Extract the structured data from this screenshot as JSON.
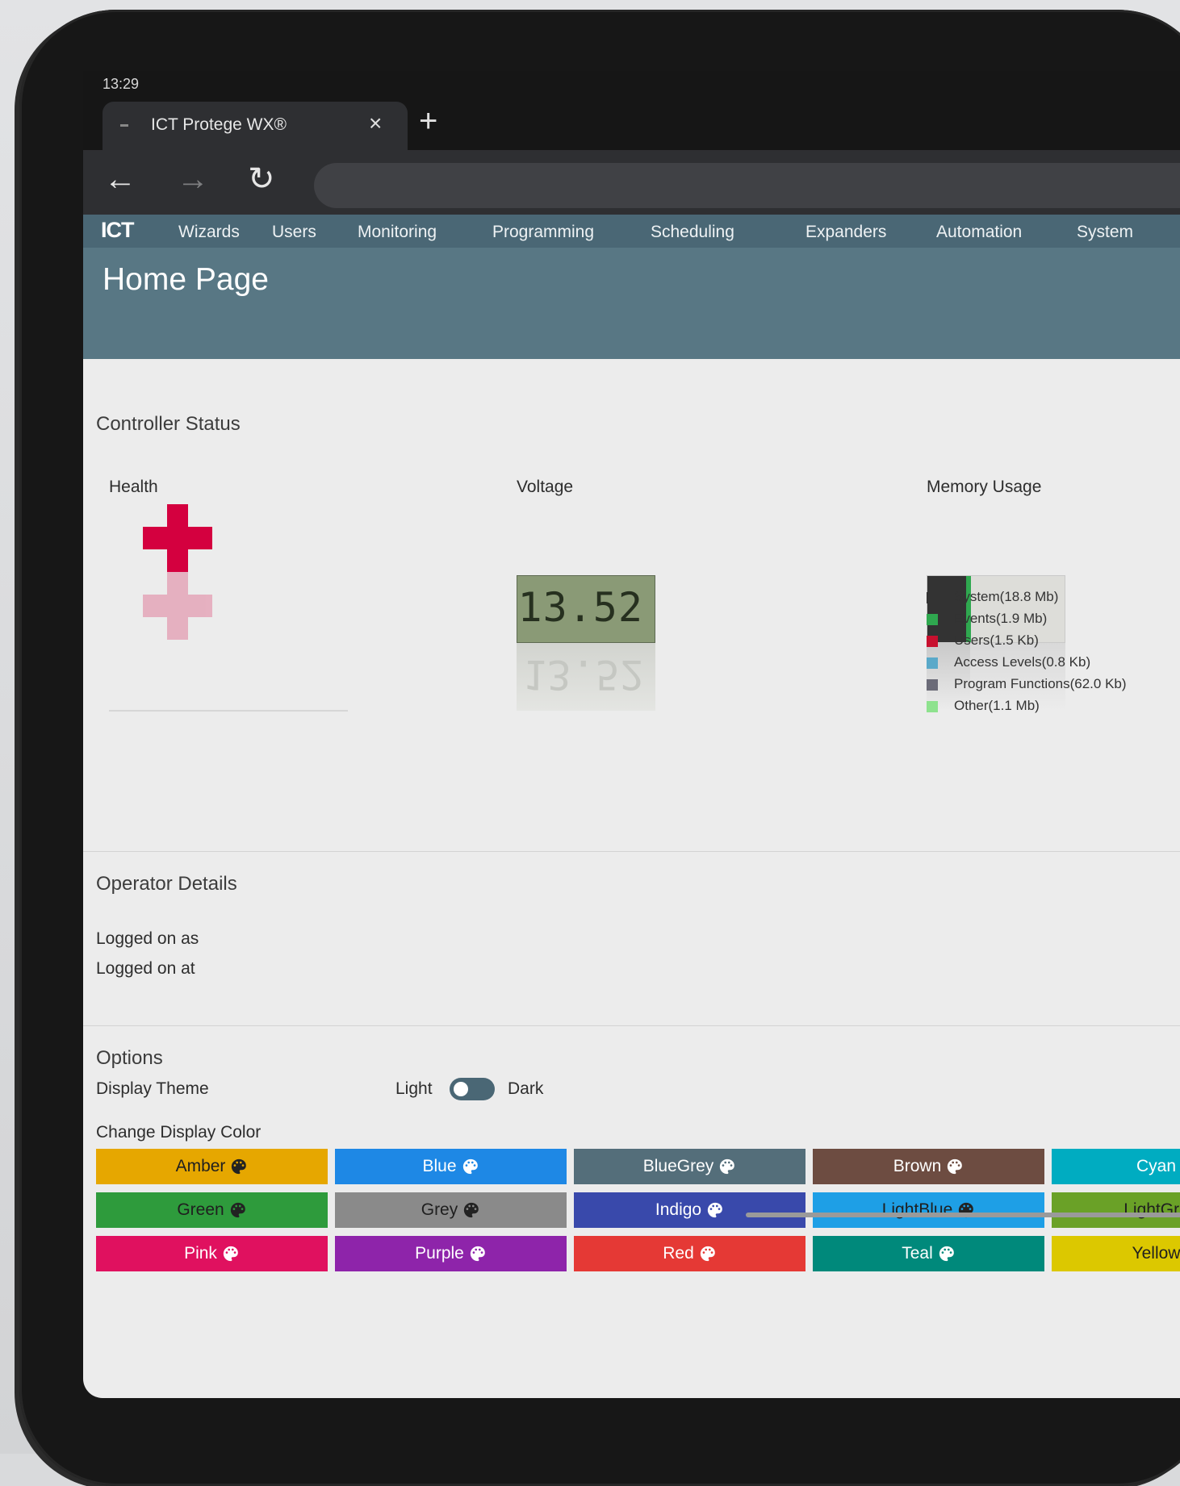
{
  "browser": {
    "clock": "13:29",
    "tab_title": "ICT Protege WX®",
    "tab_close": "×",
    "new_tab": "+",
    "back": "←",
    "forward": "→",
    "reload": "↻"
  },
  "nav": {
    "logo": "ICT",
    "items": [
      "Wizards",
      "Users",
      "Monitoring",
      "Programming",
      "Scheduling",
      "Expanders",
      "Automation",
      "System"
    ]
  },
  "page_title": "Home Page",
  "controller_status": {
    "title": "Controller Status",
    "health": {
      "label": "Health",
      "color": "#d4003f"
    },
    "voltage": {
      "label": "Voltage",
      "value": "13.52"
    },
    "memory": {
      "label": "Memory Usage",
      "legend": [
        {
          "label": "System(18.8 Mb)",
          "color": "#333333"
        },
        {
          "label": "Events(1.9 Mb)",
          "color": "#2fa84f"
        },
        {
          "label": "Users(1.5 Kb)",
          "color": "#c8102e"
        },
        {
          "label": "Access Levels(0.8 Kb)",
          "color": "#5aa9c9"
        },
        {
          "label": "Program Functions(62.0 Kb)",
          "color": "#6b6b78"
        },
        {
          "label": "Other(1.1 Mb)",
          "color": "#8ee28e"
        }
      ]
    }
  },
  "operator": {
    "title": "Operator Details",
    "logged_on_as": "Logged on as",
    "logged_on_at": "Logged on at"
  },
  "options": {
    "title": "Options",
    "display_theme": "Display Theme",
    "theme_light": "Light",
    "theme_dark": "Dark",
    "change_color": "Change Display Color",
    "colors": [
      {
        "label": "Amber",
        "color": "#e6a700"
      },
      {
        "label": "Blue",
        "color": "#1e88e5"
      },
      {
        "label": "BlueGrey",
        "color": "#546e7a"
      },
      {
        "label": "Brown",
        "color": "#6d4c41"
      },
      {
        "label": "Cyan",
        "color": "#00acc1"
      },
      {
        "label": "Green",
        "color": "#2e9b3c"
      },
      {
        "label": "Grey",
        "color": "#8a8a8a"
      },
      {
        "label": "Indigo",
        "color": "#3949ab"
      },
      {
        "label": "LightBlue",
        "color": "#1e9fe6"
      },
      {
        "label": "LightGre",
        "color": "#6aa127"
      },
      {
        "label": "Pink",
        "color": "#e0115f"
      },
      {
        "label": "Purple",
        "color": "#8e24aa"
      },
      {
        "label": "Red",
        "color": "#e53935"
      },
      {
        "label": "Teal",
        "color": "#00897b"
      },
      {
        "label": "Yellow",
        "color": "#dcc800"
      }
    ]
  }
}
